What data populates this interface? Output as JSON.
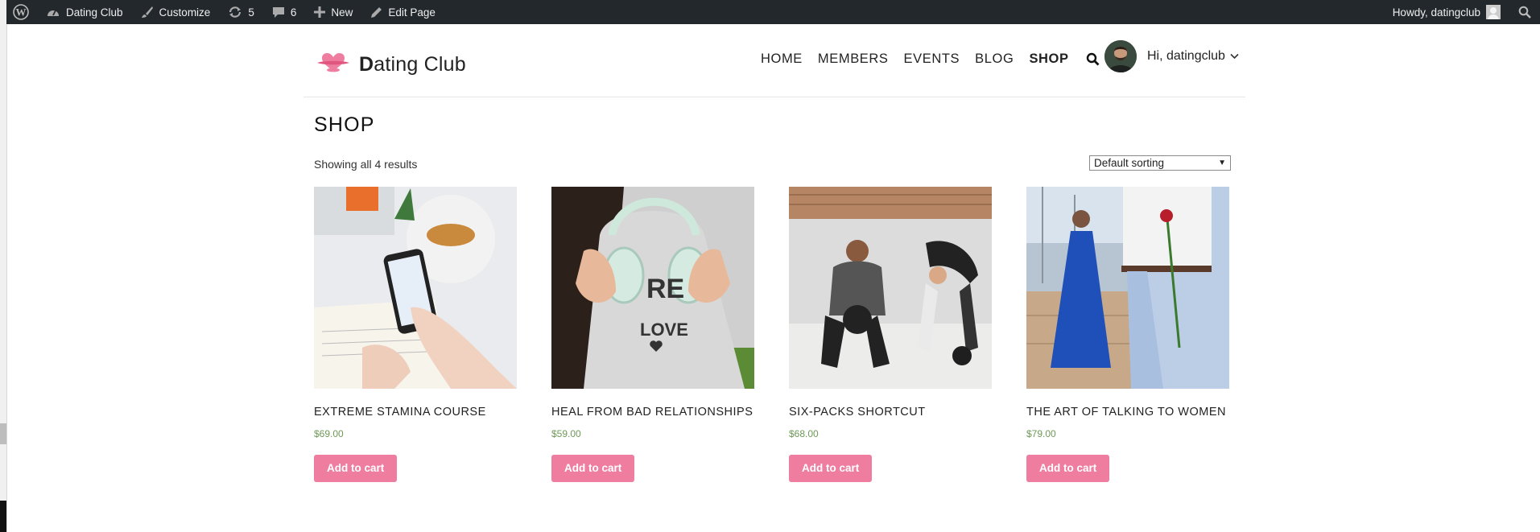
{
  "adminbar": {
    "site_name": "Dating Club",
    "customize": "Customize",
    "updates_count": "5",
    "comments_count": "6",
    "new_label": "New",
    "edit_page": "Edit Page",
    "howdy": "Howdy, datingclub"
  },
  "header": {
    "logo_initial": "D",
    "logo_rest": "ating Club",
    "nav": [
      "HOME",
      "MEMBERS",
      "EVENTS",
      "BLOG",
      "SHOP"
    ],
    "greeting": "Hi, datingclub"
  },
  "shop": {
    "title": "SHOP",
    "result_count": "Showing all 4 results",
    "sorting": "Default sorting",
    "add_to_cart": "Add to cart",
    "products": [
      {
        "title": "EXTREME STAMINA COURSE",
        "price": "$69.00"
      },
      {
        "title": "HEAL FROM BAD RELATIONSHIPS",
        "price": "$59.00"
      },
      {
        "title": "SIX-PACKS SHORTCUT",
        "price": "$68.00"
      },
      {
        "title": "THE ART OF TALKING TO WOMEN",
        "price": "$79.00"
      }
    ]
  },
  "colors": {
    "adminbar_bg": "#23282d",
    "button_pink": "#ee7da0",
    "price_green": "#6d9a57",
    "logo_pink": "#ee7da0"
  },
  "icons": [
    "wordpress-icon",
    "dashboard-icon",
    "brush-icon",
    "refresh-icon",
    "comment-icon",
    "plus-icon",
    "pencil-icon",
    "avatar-icon",
    "search-icon",
    "heart-logo-icon",
    "chevron-down-icon"
  ]
}
